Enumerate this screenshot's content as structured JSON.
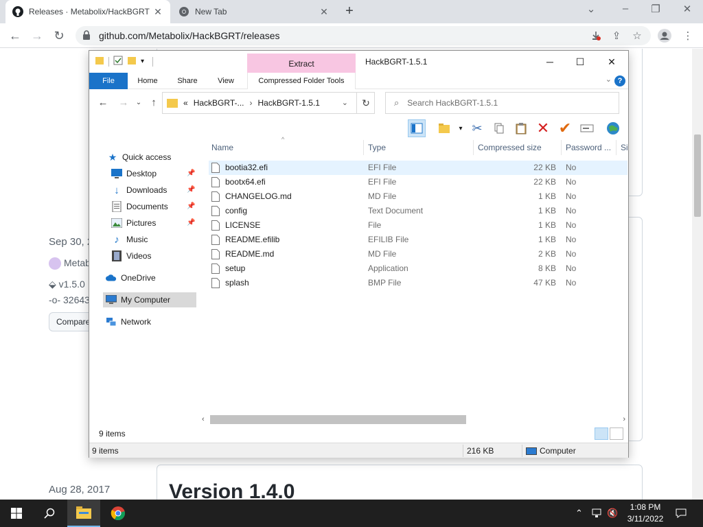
{
  "browser": {
    "tabs": [
      {
        "title": "Releases · Metabolix/HackBGRT ·",
        "active": true
      },
      {
        "title": "New Tab",
        "active": false
      }
    ],
    "url": "github.com/Metabolix/HackBGRT/releases"
  },
  "webpage": {
    "date_1": "Sep 30, 2",
    "author": "Metab",
    "tag": "v1.5.0",
    "commit": "32643",
    "compare_label": "Compare",
    "date_2": "Aug 28, 2017",
    "version_title": "Version 1.4.0"
  },
  "explorer": {
    "window_title": "HackBGRT-1.5.1",
    "context_group": "Extract",
    "ribbon_tabs": [
      "File",
      "Home",
      "Share",
      "View",
      "Compressed Folder Tools"
    ],
    "breadcrumb": {
      "prefix": "«",
      "parent": "HackBGRT-...",
      "current": "HackBGRT-1.5.1"
    },
    "search_placeholder": "Search HackBGRT-1.5.1",
    "nav": [
      {
        "label": "Quick access",
        "icon": "star-icon"
      },
      {
        "label": "Desktop",
        "icon": "desktop-icon",
        "pinned": true
      },
      {
        "label": "Downloads",
        "icon": "download-icon",
        "pinned": true
      },
      {
        "label": "Documents",
        "icon": "documents-icon",
        "pinned": true
      },
      {
        "label": "Pictures",
        "icon": "pictures-icon",
        "pinned": true
      },
      {
        "label": "Music",
        "icon": "music-icon"
      },
      {
        "label": "Videos",
        "icon": "videos-icon"
      },
      {
        "label": "OneDrive",
        "icon": "cloud-icon"
      },
      {
        "label": "My Computer",
        "icon": "computer-icon",
        "selected": true
      },
      {
        "label": "Network",
        "icon": "network-icon"
      }
    ],
    "columns": [
      "Name",
      "Type",
      "Compressed size",
      "Password ...",
      "Si"
    ],
    "files": [
      {
        "name": "bootia32.efi",
        "type": "EFI File",
        "size": "22 KB",
        "password": "No"
      },
      {
        "name": "bootx64.efi",
        "type": "EFI File",
        "size": "22 KB",
        "password": "No"
      },
      {
        "name": "CHANGELOG.md",
        "type": "MD File",
        "size": "1 KB",
        "password": "No"
      },
      {
        "name": "config",
        "type": "Text Document",
        "size": "1 KB",
        "password": "No"
      },
      {
        "name": "LICENSE",
        "type": "File",
        "size": "1 KB",
        "password": "No"
      },
      {
        "name": "README.efilib",
        "type": "EFILIB File",
        "size": "1 KB",
        "password": "No"
      },
      {
        "name": "README.md",
        "type": "MD File",
        "size": "2 KB",
        "password": "No"
      },
      {
        "name": "setup",
        "type": "Application",
        "size": "8 KB",
        "password": "No"
      },
      {
        "name": "splash",
        "type": "BMP File",
        "size": "47 KB",
        "password": "No"
      }
    ],
    "item_count": "9 items",
    "status": {
      "items": "9 items",
      "size": "216 KB",
      "location": "Computer"
    }
  },
  "taskbar": {
    "time": "1:08 PM",
    "date": "3/11/2022"
  },
  "colors": {
    "ribbon_file": "#1a73c9",
    "context_tab": "#f8c6e2",
    "selection": "#cce4f7",
    "taskbar": "#1f1f1f"
  }
}
